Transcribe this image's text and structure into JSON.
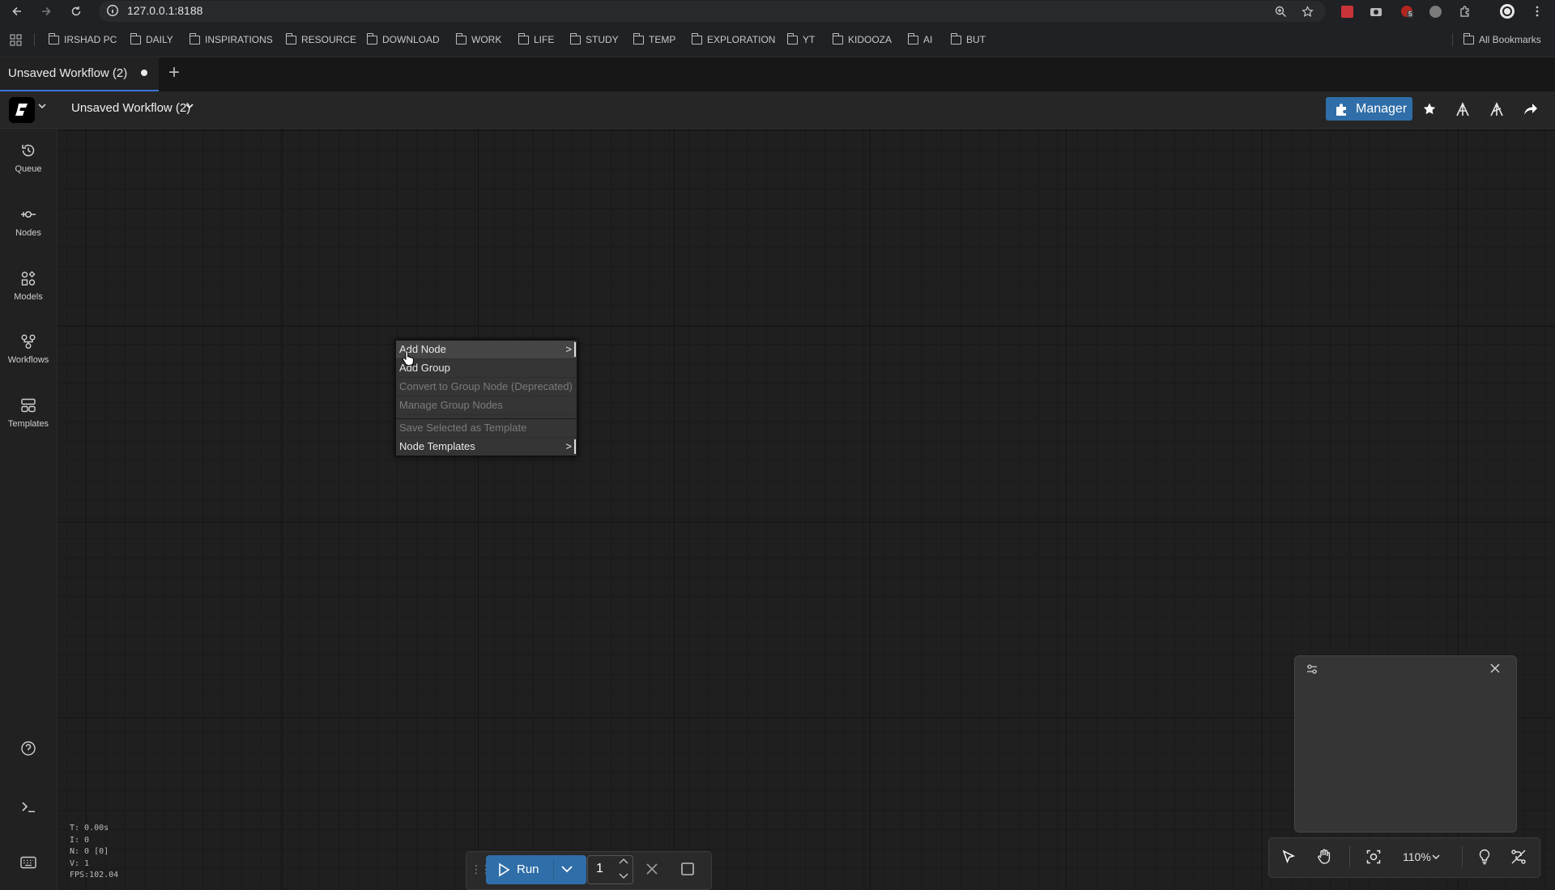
{
  "browser": {
    "url": "127.0.0.1:8188",
    "bookmarks": [
      "IRSHAD PC",
      "DAILY",
      "INSPIRATIONS",
      "RESOURCE",
      "DOWNLOAD",
      "WORK",
      "LIFE",
      "STUDY",
      "TEMP",
      "EXPLORATION",
      "YT",
      "KIDOOZA",
      "AI",
      "BUT"
    ],
    "all_bookmarks": "All Bookmarks",
    "tab_title": "Unsaved Workflow (2)",
    "extension_badge": "5"
  },
  "header": {
    "workflow_title": "Unsaved Workflow (2)",
    "manager_label": "Manager"
  },
  "sidebar": {
    "items": [
      {
        "label": "Queue",
        "icon": "history-icon"
      },
      {
        "label": "Nodes",
        "icon": "nodes-icon"
      },
      {
        "label": "Models",
        "icon": "models-icon"
      },
      {
        "label": "Workflows",
        "icon": "workflows-icon"
      },
      {
        "label": "Templates",
        "icon": "templates-icon"
      }
    ]
  },
  "context_menu": {
    "add_node": "Add Node",
    "add_group": "Add Group",
    "convert_group": "Convert to Group Node (Deprecated)",
    "manage_group": "Manage Group Nodes",
    "save_template": "Save Selected as Template",
    "node_templates": "Node Templates",
    "submenu_arrow": ">"
  },
  "stats": {
    "t": "T: 0.00s",
    "i": "I: 0",
    "n": "N: 0 [0]",
    "v": "V: 1",
    "fps": "FPS:102.04"
  },
  "run_toolbar": {
    "run_label": "Run",
    "batch_count": "1"
  },
  "canvas_controls": {
    "zoom": "110%"
  },
  "colors": {
    "accent": "#2f6ea8",
    "tab_indicator": "#3a74d6"
  }
}
